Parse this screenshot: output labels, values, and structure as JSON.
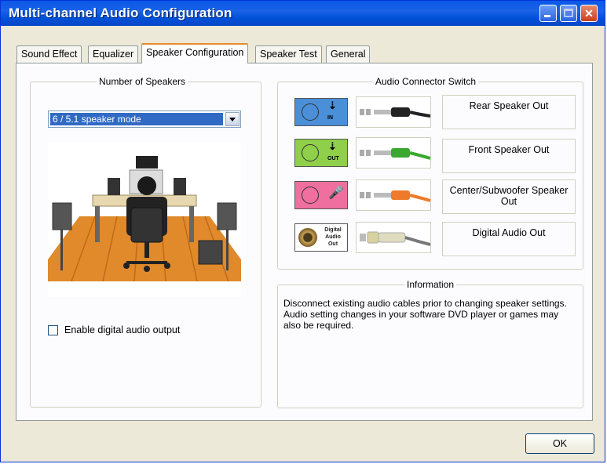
{
  "window": {
    "title": "Multi-channel Audio Configuration"
  },
  "tabs": [
    "Sound Effect",
    "Equalizer",
    "Speaker Configuration",
    "Speaker Test",
    "General"
  ],
  "active_tab": "Speaker Configuration",
  "speakers": {
    "legend": "Number of Speakers",
    "mode_selected": "6 / 5.1 speaker mode",
    "digital_checkbox_label": "Enable digital audio output",
    "digital_checkbox_checked": false
  },
  "connectors": {
    "legend": "Audio Connector Switch",
    "items": [
      {
        "jack_tag": "IN",
        "jack_color": "#4a8fd8",
        "cable_color": "#222222",
        "label": "Rear Speaker Out"
      },
      {
        "jack_tag": "OUT",
        "jack_color": "#8fcf4a",
        "cable_color": "#3aa830",
        "label": "Front Speaker Out"
      },
      {
        "jack_tag": "",
        "jack_color": "#ef6f9f",
        "cable_color": "#ee7a2a",
        "label": "Center/Subwoofer Speaker Out"
      },
      {
        "jack_text": "Digital Audio Out",
        "jack_color": "#ffffff",
        "cable_color": "#d8d2a0",
        "label": "Digital Audio Out"
      }
    ]
  },
  "information": {
    "legend": "Information",
    "text": "Disconnect existing audio cables prior to changing speaker settings. Audio setting changes in your software DVD player or games may also be required."
  },
  "buttons": {
    "ok": "OK"
  }
}
